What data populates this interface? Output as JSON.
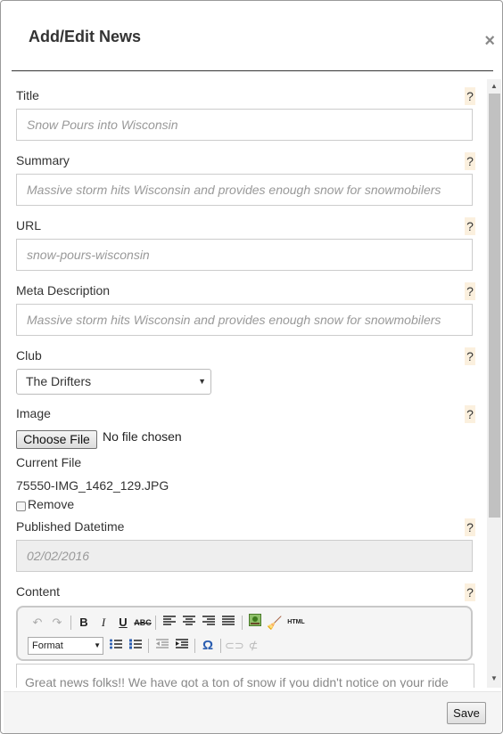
{
  "header": {
    "title": "Add/Edit News",
    "close_label": "×"
  },
  "help_label": "?",
  "fields": {
    "title": {
      "label": "Title",
      "placeholder": "Snow Pours into Wisconsin"
    },
    "summary": {
      "label": "Summary",
      "placeholder": "Massive storm hits Wisconsin and provides enough snow for snowmobilers"
    },
    "url": {
      "label": "URL",
      "placeholder": "snow-pours-wisconsin"
    },
    "meta_description": {
      "label": "Meta Description",
      "placeholder": "Massive storm hits Wisconsin and provides enough snow for snowmobilers"
    },
    "club": {
      "label": "Club",
      "selected": "The Drifters"
    },
    "image": {
      "label": "Image",
      "choose_label": "Choose File",
      "no_file": "No file chosen"
    },
    "current_file": {
      "label": "Current File",
      "value": "75550-IMG_1462_129.JPG",
      "remove_label": "Remove"
    },
    "published": {
      "label": "Published Datetime",
      "value": "02/02/2016"
    },
    "content": {
      "label": "Content",
      "format_label": "Format",
      "html_label": "HTML",
      "text": "Great news folks!! We have got a ton of snow if you didn't notice on your ride"
    }
  },
  "footer": {
    "save_label": "Save"
  },
  "colors": {
    "help_bg": "#fbf0de",
    "disabled_bg": "#eeeeee"
  }
}
